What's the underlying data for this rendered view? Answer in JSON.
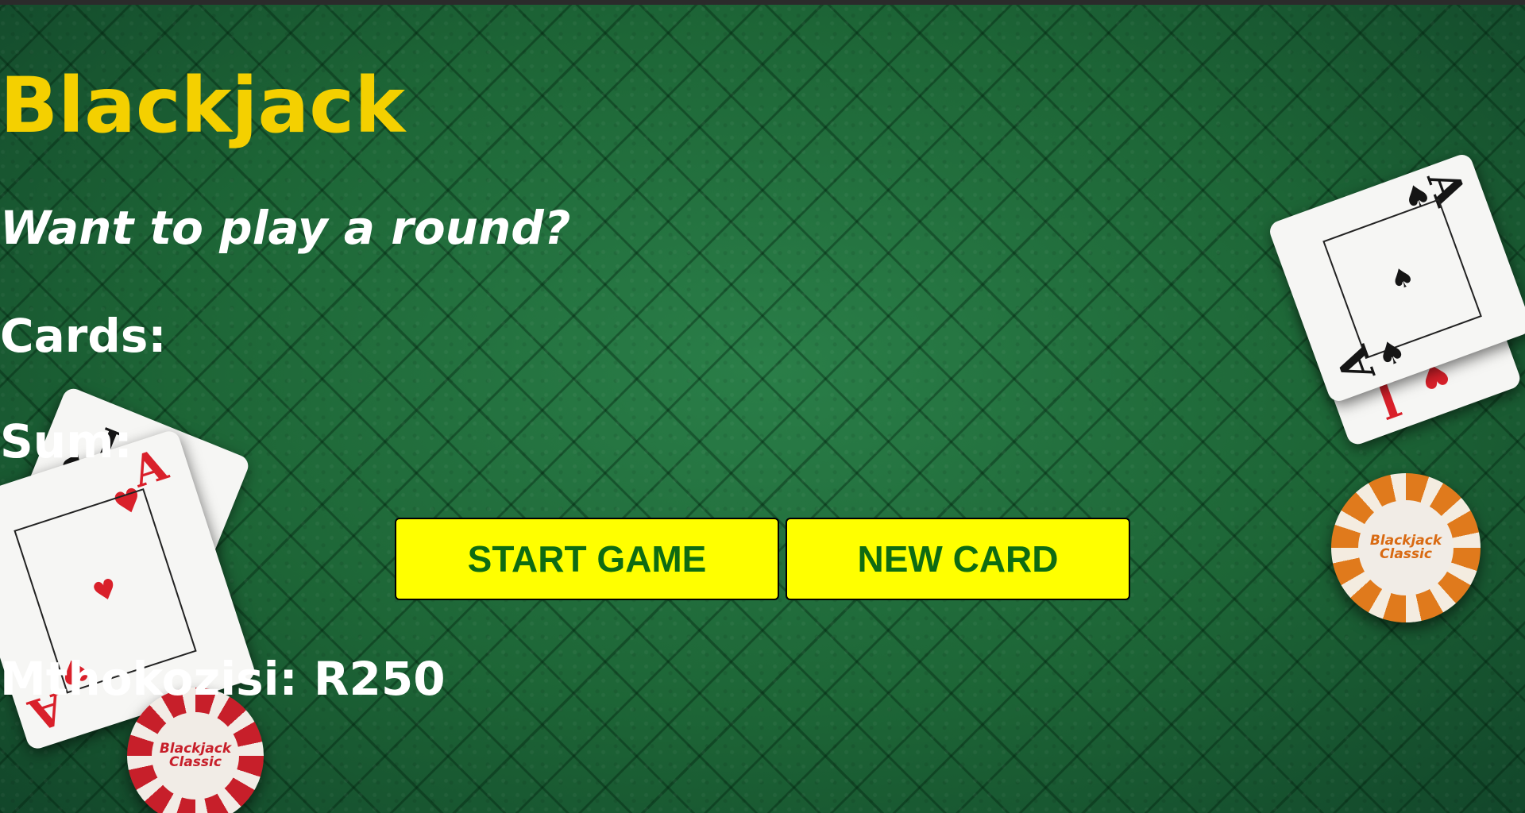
{
  "game": {
    "title": "Blackjack",
    "message": "Want to play a round?",
    "cards_label": "Cards:",
    "sum_label": "Sum:",
    "start_button": "START GAME",
    "new_card_button": "NEW CARD",
    "player_info": "Mthokozisi: R250"
  },
  "decor": {
    "chip_logo_line1": "Blackjack",
    "chip_logo_line2": "Classic",
    "left_cards": [
      {
        "rank": "J",
        "suit": "♠"
      },
      {
        "rank": "A",
        "suit": "♥"
      }
    ],
    "right_cards": [
      {
        "rank": "A",
        "suit": "♠"
      },
      {
        "rank": "J",
        "suit": "♥"
      }
    ]
  },
  "colors": {
    "title": "#f4d000",
    "button_bg": "#ffff00",
    "button_text": "#0e6b12",
    "felt": "#1f6a3a"
  }
}
